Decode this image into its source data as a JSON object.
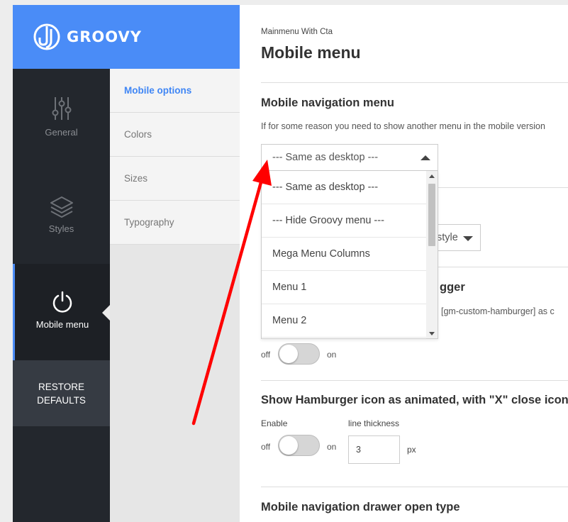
{
  "app": {
    "logo_text": "GROOVY",
    "accent": "#4a8cf7"
  },
  "nav": {
    "items": [
      {
        "label": "General",
        "icon": "sliders-icon"
      },
      {
        "label": "Styles",
        "icon": "layers-icon"
      },
      {
        "label": "Mobile menu",
        "icon": "power-icon"
      }
    ],
    "restore": "RESTORE DEFAULTS"
  },
  "subnav": {
    "items": [
      {
        "label": "Mobile options"
      },
      {
        "label": "Colors"
      },
      {
        "label": "Sizes"
      },
      {
        "label": "Typography"
      }
    ]
  },
  "main": {
    "breadcrumb": "Mainmenu With Cta",
    "title": "Mobile menu",
    "section1": {
      "title": "Mobile navigation menu",
      "desc": "If for some reason you need to show another menu in the mobile version"
    },
    "select": {
      "value": "--- Same as desktop ---",
      "options": [
        "--- Same as desktop ---",
        "--- Hide Groovy menu ---",
        "Mega Menu Columns",
        "Menu 1",
        "Menu 2"
      ]
    },
    "style_select": "style",
    "section3": {
      "title_visible": "gger",
      "desc_visible": "[gm-custom-hamburger] as c"
    },
    "toggle1": {
      "off": "off",
      "on": "on"
    },
    "section4": {
      "title": "Show Hamburger icon as animated, with \"X\" close icon",
      "enable_label": "Enable",
      "thickness_label": "line thickness",
      "off": "off",
      "on": "on",
      "thickness_value": "3",
      "unit": "px"
    },
    "section5": {
      "title": "Mobile navigation drawer open type"
    }
  }
}
